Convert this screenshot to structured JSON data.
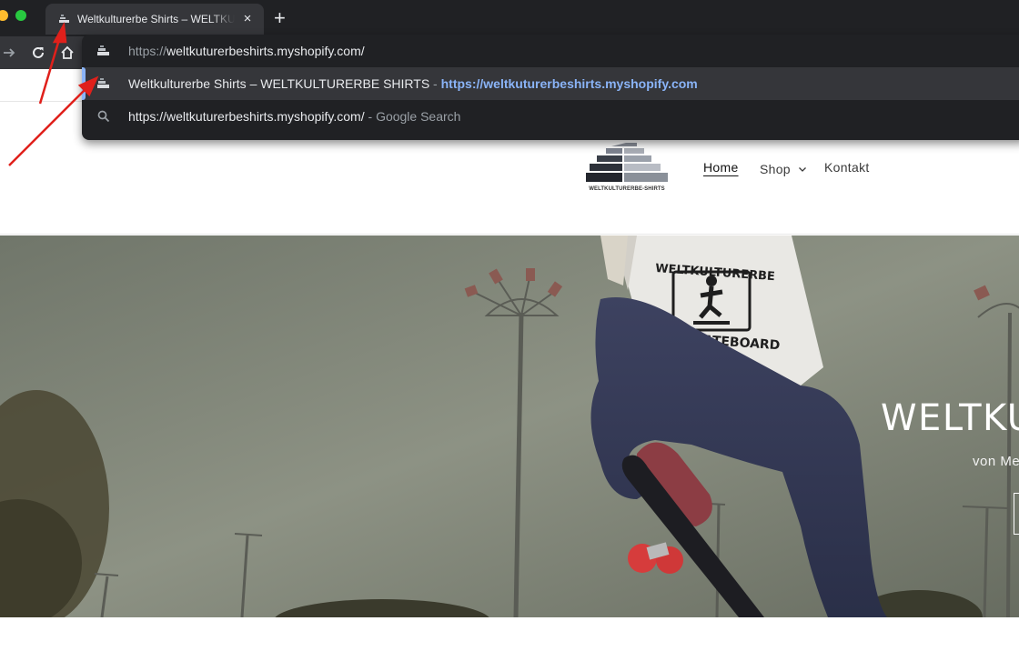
{
  "browser": {
    "tab": {
      "title": "Weltkulturerbe Shirts – WELTKULTURERBE SHIRTS",
      "close_glyph": "×"
    },
    "new_tab_glyph": "+",
    "icons": [
      "back-icon",
      "forward-icon",
      "reload-icon",
      "home-icon"
    ],
    "omnibox": {
      "input_scheme": "https://",
      "input_host": "weltkuturerbeshirts.myshopify.com/",
      "suggestions": [
        {
          "title": "Weltkulturerbe Shirts – WELTKULTURERBE SHIRTS",
          "separator": " - ",
          "url": "https://weltkuturerbeshirts.myshopify.com",
          "icon": "site-favicon"
        },
        {
          "title": "https://weltkuturerbeshirts.myshopify.com/",
          "separator": " - ",
          "hint": "Google Search",
          "icon": "search-icon"
        }
      ],
      "accent_color": "#8ab4f8"
    }
  },
  "site": {
    "logo_text": "WELTKULTURERBE-SHIRTS",
    "nav": {
      "home": "Home",
      "shop": "Shop",
      "kontakt": "Kontakt"
    },
    "hero": {
      "title": "WELTKUL",
      "subtitle": "von Me",
      "shirt_text_top": "WELTKULTURERBE",
      "shirt_text_bottom": "SKATEBOARD"
    }
  },
  "colors": {
    "chrome_dark": "#202124",
    "chrome_tab": "#35363a",
    "annotation_red": "#e0201b"
  }
}
